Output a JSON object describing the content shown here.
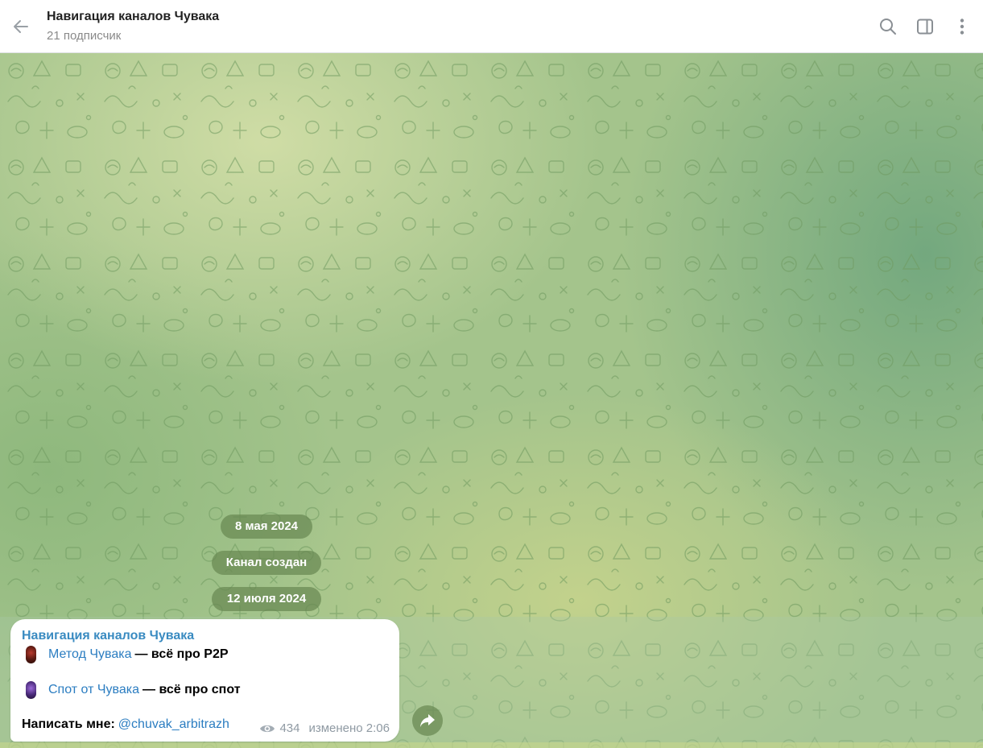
{
  "header": {
    "title": "Навигация каналов Чувака",
    "subtitle": "21 подписчик",
    "icons": [
      "back-arrow-icon",
      "search-icon",
      "sidebar-toggle-icon",
      "more-vertical-icon"
    ]
  },
  "service": {
    "date1": "8 мая 2024",
    "channel_created": "Канал создан",
    "date2": "12 июля 2024"
  },
  "message": {
    "author": "Навигация каналов Чувака",
    "line1": {
      "emoji": "red-pin-emoji",
      "link": "Метод Чувака",
      "text": "— всё про P2P"
    },
    "line2": {
      "emoji": "purple-pin-emoji",
      "link": "Спот от Чувака",
      "text": "— всё про спот"
    },
    "line3": {
      "text": "Написать мне:",
      "link": "@chuvak_arbitrazh"
    },
    "views": "434",
    "edited_time": "изменено 2:06"
  },
  "colors": {
    "header_bg": "#ffffff",
    "title": "#222222",
    "subtitle": "#8a8a8a",
    "link": "#2b7dc1",
    "author": "#3a8bc1",
    "pill_bg": "#688852",
    "chat_bg": "#a4c48c"
  }
}
